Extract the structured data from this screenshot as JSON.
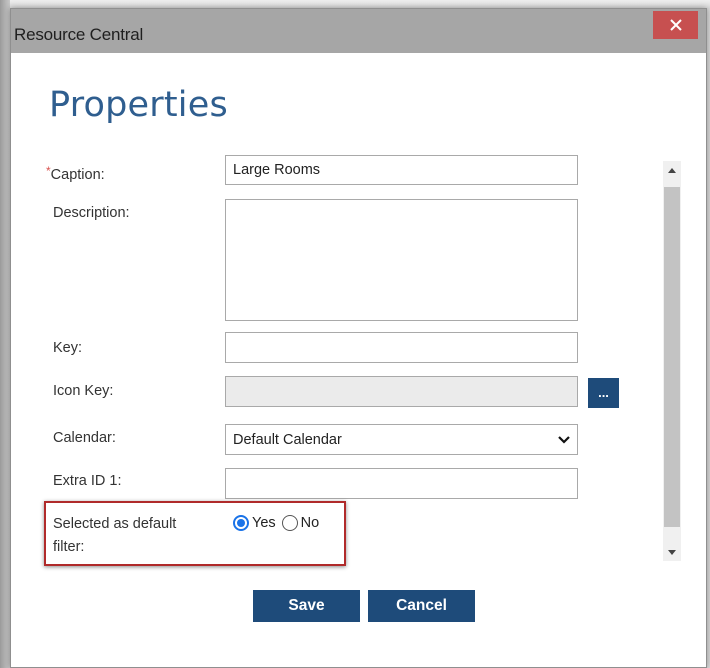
{
  "window": {
    "title": "Resource Central",
    "close_label": "×"
  },
  "page": {
    "heading": "Properties"
  },
  "form": {
    "caption": {
      "label": "Caption:",
      "required_mark": "*",
      "value": "Large Rooms"
    },
    "description": {
      "label": "Description:",
      "value": ""
    },
    "key": {
      "label": "Key:",
      "value": ""
    },
    "icon_key": {
      "label": "Icon Key:",
      "value": "",
      "browse_label": "..."
    },
    "calendar": {
      "label": "Calendar:",
      "value": "Default Calendar"
    },
    "extra_id_1": {
      "label": "Extra ID 1:",
      "value": ""
    },
    "default_filter": {
      "label_line1": "Selected as default",
      "label_line2": "filter:",
      "options": [
        "Yes",
        "No"
      ],
      "selected": "Yes"
    }
  },
  "actions": {
    "save_label": "Save",
    "cancel_label": "Cancel"
  },
  "colors": {
    "accent": "#1e4b7a",
    "heading": "#2f5e8f",
    "close": "#c75050",
    "highlight": "#b02a2a",
    "radio": "#1a73e8"
  }
}
